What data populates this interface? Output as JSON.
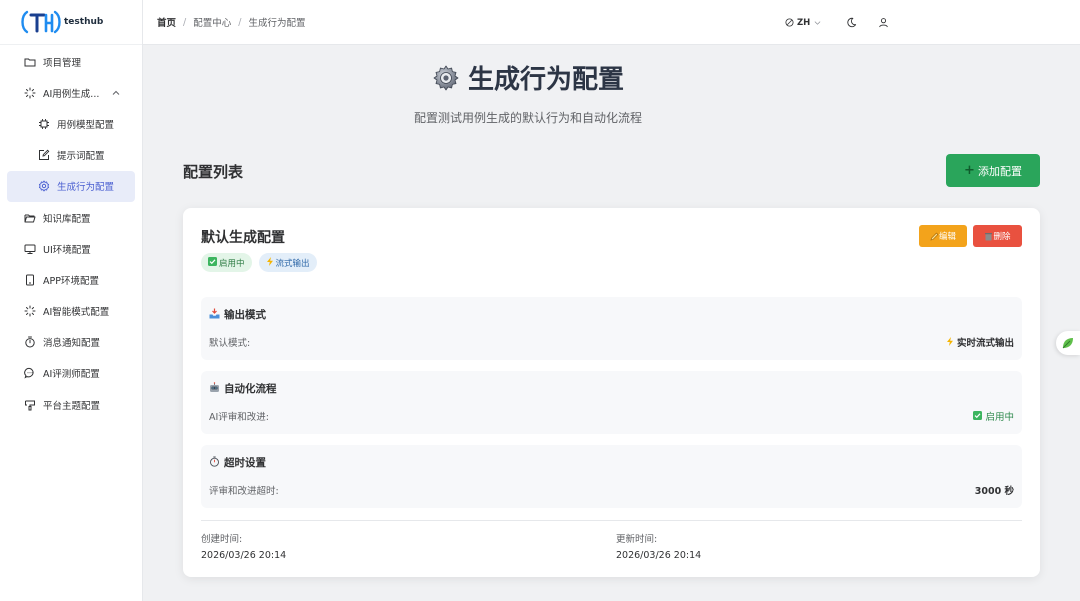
{
  "app": {
    "logo_text": "testhub"
  },
  "sidebar": {
    "items": [
      {
        "label": "项目管理",
        "icon": "folder-icon"
      },
      {
        "label": "AI用例生成...",
        "icon": "sparkle-icon",
        "expanded": true
      },
      {
        "label": "用例模型配置",
        "icon": "chip-icon",
        "sub": true
      },
      {
        "label": "提示词配置",
        "icon": "edit-icon",
        "sub": true
      },
      {
        "label": "生成行为配置",
        "icon": "gear-icon",
        "sub": true,
        "active": true
      },
      {
        "label": "知识库配置",
        "icon": "folder-open-icon"
      },
      {
        "label": "UI环境配置",
        "icon": "monitor-icon"
      },
      {
        "label": "APP环境配置",
        "icon": "phone-icon"
      },
      {
        "label": "AI智能模式配置",
        "icon": "sparkle-icon"
      },
      {
        "label": "消息通知配置",
        "icon": "timer-icon"
      },
      {
        "label": "AI评测师配置",
        "icon": "chat-icon"
      },
      {
        "label": "平台主题配置",
        "icon": "palette-icon"
      }
    ]
  },
  "header": {
    "breadcrumb": [
      "首页",
      "配置中心",
      "生成行为配置"
    ],
    "lang": "ZH"
  },
  "page": {
    "title": "生成行为配置",
    "subtitle": "配置测试用例生成的默认行为和自动化流程",
    "list_title": "配置列表",
    "add_button": "添加配置"
  },
  "card": {
    "title": "默认生成配置",
    "tags": [
      "启用中",
      "流式输出"
    ],
    "edit_label": "编辑",
    "delete_label": "删除",
    "sections": [
      {
        "title": "输出模式",
        "label": "默认模式:",
        "value": "实时流式输出"
      },
      {
        "title": "自动化流程",
        "label": "AI评审和改进:",
        "value": "启用中"
      },
      {
        "title": "超时设置",
        "label": "评审和改进超时:",
        "value": "3000 秒"
      }
    ],
    "created_label": "创建时间:",
    "created_value": "2026/03/26 20:14",
    "updated_label": "更新时间:",
    "updated_value": "2026/03/26 20:14"
  },
  "colors": {
    "accent": "#4a5fd1",
    "success_button": "#2aa55b",
    "edit_button": "#f3a31b",
    "delete_button": "#e9513f"
  }
}
